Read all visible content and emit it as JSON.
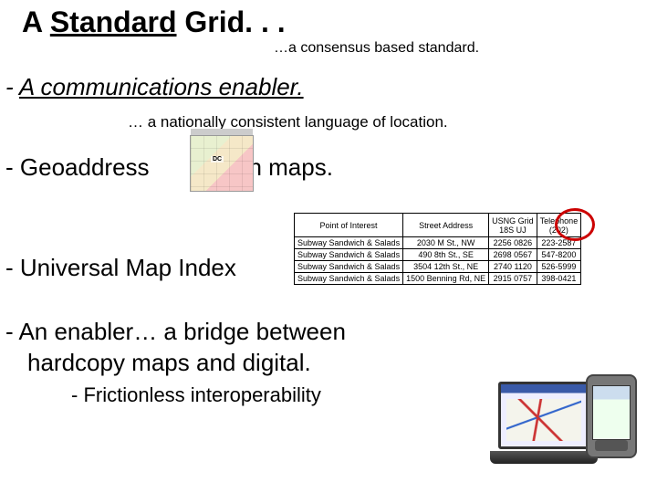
{
  "title": {
    "pre": "A ",
    "mid": "Standard",
    "post": " Grid. . ."
  },
  "sub_right": "…a consensus based standard.",
  "line1": {
    "pre": "- ",
    "text": "A communications enabler."
  },
  "line2": "… a nationally consistent language of location.",
  "line3_pre": "- Geoaddress",
  "line3_post": "on maps.",
  "line4": "- Universal Map Index",
  "table": {
    "headers": [
      "Point of Interest",
      "Street Address",
      "USNG Grid\n18S UJ",
      "Telephone\n(202)"
    ],
    "rows": [
      [
        "Subway Sandwich & Salads",
        "2030 M St., NW",
        "2256 0826",
        "223-2587"
      ],
      [
        "Subway Sandwich & Salads",
        "490 8th St., SE",
        "2698 0567",
        "547-8200"
      ],
      [
        "Subway Sandwich & Salads",
        "3504 12th St., NE",
        "2740 1120",
        "526-5999"
      ],
      [
        "Subway Sandwich & Salads",
        "1500 Benning Rd, NE",
        "2915 0757",
        "398-0421"
      ]
    ]
  },
  "line5": "- An enabler…  a bridge between",
  "line5b": "hardcopy maps and digital.",
  "line6": "- Frictionless interoperability"
}
